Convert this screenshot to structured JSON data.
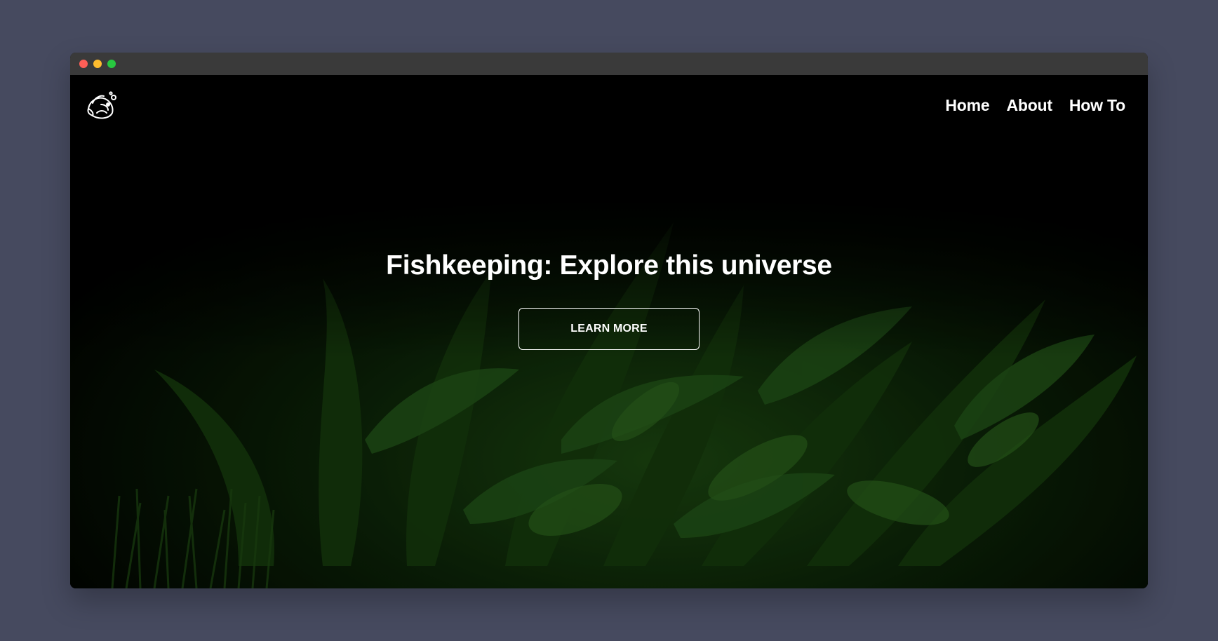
{
  "page": {
    "background_color": "#464a5f"
  },
  "window": {
    "titlebar_color": "#3a3a3a",
    "buttons": [
      "close",
      "minimize",
      "maximize"
    ]
  },
  "navbar": {
    "logo_icon": "fish-icon",
    "links": [
      {
        "label": "Home"
      },
      {
        "label": "About"
      },
      {
        "label": "How To"
      }
    ]
  },
  "hero": {
    "title": "Fishkeeping: Explore this universe",
    "cta_label": "LEARN MORE",
    "background": "dark aquarium plants"
  }
}
